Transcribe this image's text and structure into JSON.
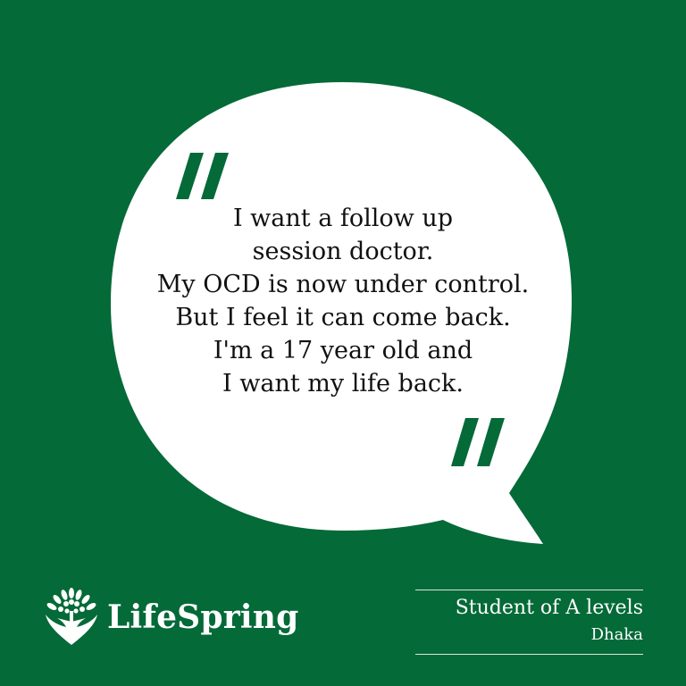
{
  "colors": {
    "background": "#046a38",
    "bubble": "#ffffff",
    "quote_marks": "#046a38",
    "text": "#111111"
  },
  "quote": {
    "lines": [
      "I want a follow up",
      "session doctor.",
      "My OCD is now under control.",
      "But I feel it can come back.",
      "I'm a 17 year old and",
      "I want my life back."
    ],
    "open_mark": "quote-open-icon",
    "close_mark": "quote-close-icon"
  },
  "brand": {
    "name": "LifeSpring",
    "logo": "tree-heart-logo-icon"
  },
  "attribution": {
    "role": "Student of A levels",
    "place": "Dhaka"
  }
}
